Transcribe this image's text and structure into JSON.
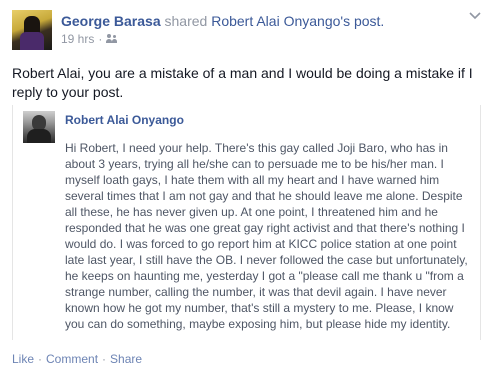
{
  "post": {
    "actor_name": "George Barasa",
    "shared_text": "shared",
    "owner_name": "Robert Alai Onyango",
    "owner_suffix": "'s post.",
    "timestamp": "19 hrs",
    "separator": "·",
    "audience_icon": "friends-icon",
    "status_text": "Robert Alai, you are a mistake of a man and I would be doing a mistake if I reply to your post."
  },
  "shared_post": {
    "author_name": "Robert Alai Onyango",
    "body": "Hi Robert, I need your help. There's this gay called Joji Baro, who has in about 3 years, trying all he/she can to persuade me to be his/her man. I myself loath gays, I hate them with all my heart and I have warned him several times that I am not gay and that he should leave me alone. Despite all these, he has never given up. At one point, I threatened him and he responded that he was one great gay right activist and that there's nothing I would do. I was forced to go report him at KICC police station at one point late last year, I still have the OB. I never followed the case but unfortunately, he keeps on haunting me, yesterday I got a \"please call me thank u \"from a strange number, calling the number, it was that devil again. I have never known how he got my number, that's still a mystery to me. Please, I know you can do something, maybe exposing him, but please hide my identity."
  },
  "actions": {
    "like": "Like",
    "comment": "Comment",
    "share": "Share",
    "separator": "·"
  },
  "colors": {
    "link": "#3b5998",
    "muted": "#9197a3",
    "text": "#141823"
  }
}
